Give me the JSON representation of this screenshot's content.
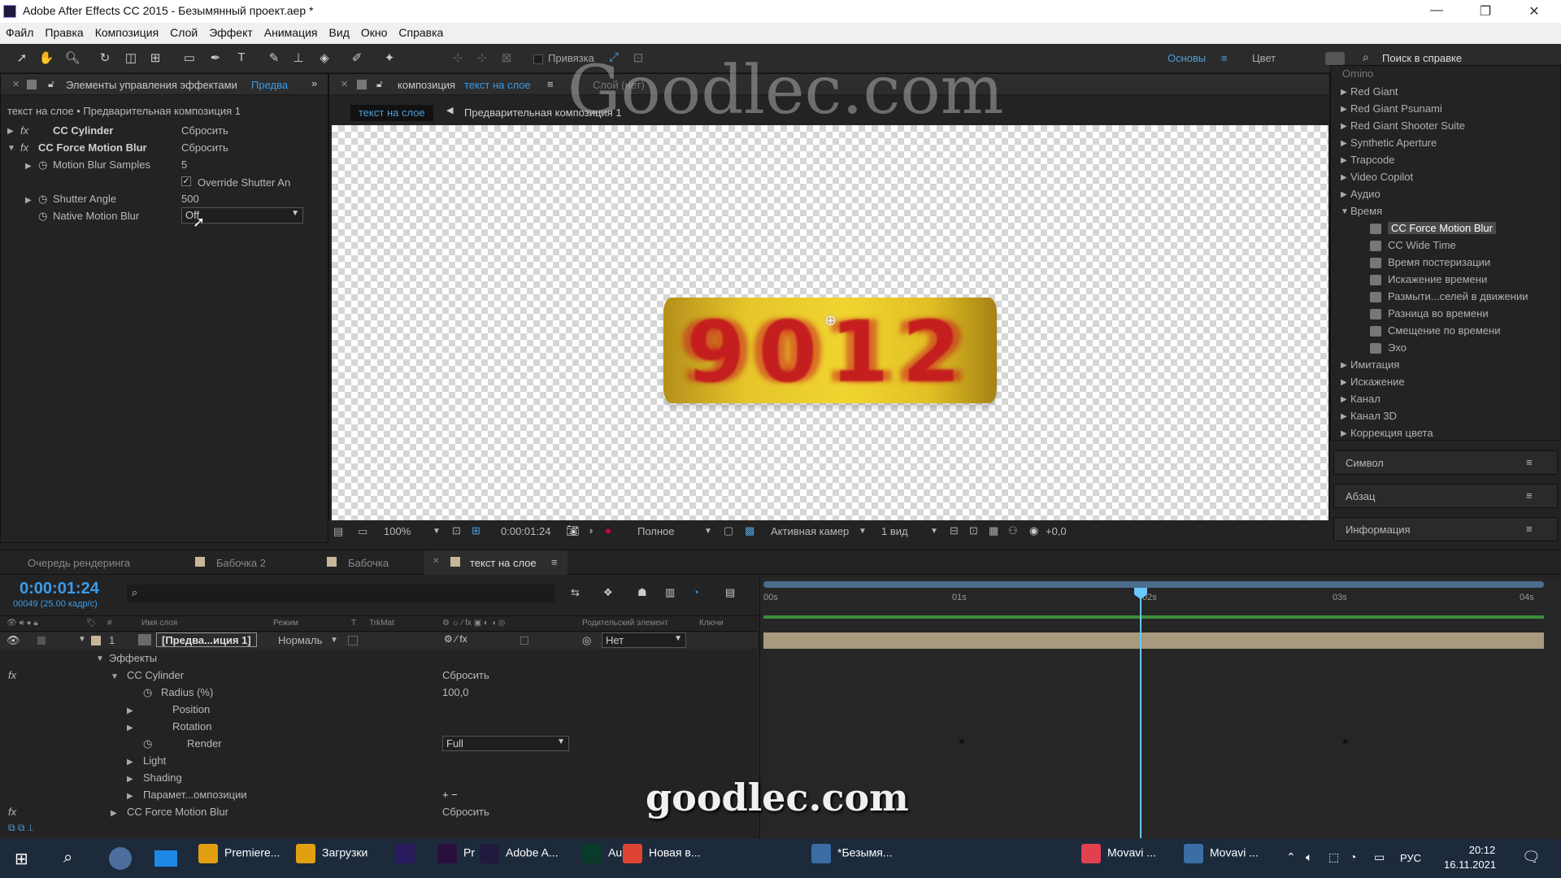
{
  "window": {
    "title": "Adobe After Effects CC 2015 - Безымянный проект.aep *"
  },
  "menu": [
    "Файл",
    "Правка",
    "Композиция",
    "Слой",
    "Эффект",
    "Анимация",
    "Вид",
    "Окно",
    "Справка"
  ],
  "toolbar": {
    "snap_label": "Привязка",
    "workspace_basics": "Основы",
    "workspace_color": "Цвет",
    "help_search_placeholder": "Поиск в справке"
  },
  "effects_panel": {
    "tab_label": "Элементы управления эффектами",
    "tab_suffix": "Предва",
    "breadcrumb": "текст на слое • Предварительная композиция 1",
    "effects": [
      {
        "name": "CC Cylinder",
        "reset": "Сбросить"
      },
      {
        "name": "CC Force Motion Blur",
        "reset": "Сбросить"
      }
    ],
    "motion_blur_samples": {
      "label": "Motion Blur Samples",
      "value": "5"
    },
    "override_shutter": {
      "label": "Override Shutter An",
      "checked": true
    },
    "shutter_angle": {
      "label": "Shutter Angle",
      "value": "500"
    },
    "native_motion_blur": {
      "label": "Native Motion Blur",
      "value": "Off"
    }
  },
  "composition_panel": {
    "tab_prefix": "композиция",
    "tab_name": "текст на слое",
    "layer_tab": "Слой (нет)",
    "crumbs": [
      "текст на слое",
      "Предварительная композиция 1"
    ],
    "cylinder_text": "9012",
    "footer": {
      "zoom": "100%",
      "timecode": "0:00:01:24",
      "resolution": "Полное",
      "camera": "Активная камер",
      "views": "1 вид",
      "exposure": "+0,0"
    }
  },
  "watermarks": {
    "top": "Goodlec.com",
    "bottom": "goodlec.com"
  },
  "effects_presets": {
    "partial_top": "Omino",
    "items": [
      "Red Giant",
      "Red Giant Psunami",
      "Red Giant Shooter Suite",
      "Synthetic Aperture",
      "Trapcode",
      "Video Copilot",
      "Аудио"
    ],
    "open_group": "Время",
    "time_effects": [
      "CC Force Motion Blur",
      "CC Wide Time",
      "Время постеризации",
      "Искажение времени",
      "Размыти...селей в движении",
      "Разница во времени",
      "Смещение по времени",
      "Эхо"
    ],
    "after_groups": [
      "Имитация",
      "Искажение",
      "Канал",
      "Канал 3D",
      "Коррекция цвета"
    ]
  },
  "side_panels": [
    "Символ",
    "Абзац",
    "Информация"
  ],
  "timeline": {
    "tabs": [
      "Очередь рендеринга",
      "Бабочка 2",
      "Бабочка",
      "текст на слое"
    ],
    "timecode": "0:00:01:24",
    "frame_info": "00049 (25.00 кадр/с)",
    "columns": {
      "name": "Имя слоя",
      "mode": "Режим",
      "t": "T",
      "trkmat": "TrkMat",
      "parent": "Родительский элемент",
      "keys": "Ключи"
    },
    "layer": {
      "num": "1",
      "name": "[Предва...иция 1]",
      "mode": "Нормаль",
      "parent": "Нет"
    },
    "effects_group": "Эффекты",
    "cc_cylinder": {
      "name": "CC Cylinder",
      "reset": "Сбросить"
    },
    "radius": {
      "label": "Radius (%)",
      "value": "100,0"
    },
    "props": [
      "Position",
      "Rotation"
    ],
    "render": {
      "label": "Render",
      "value": "Full"
    },
    "props2": [
      "Light",
      "Shading",
      "Парамет...омпозиции"
    ],
    "param_ops": "+ −",
    "cc_force": {
      "name": "CC Force Motion Blur",
      "reset": "Сбросить"
    },
    "ruler": [
      "00s",
      "01s",
      "02s",
      "03s",
      "04s"
    ]
  },
  "taskbar": {
    "apps": [
      "Premiere...",
      "Загрузки",
      "",
      "Pr",
      "Adobe A...",
      "Au",
      "Новая в...",
      "*Безымя...",
      "Movavi ...",
      "Movavi ..."
    ],
    "lang": "РУС",
    "time": "20:12",
    "date": "16.11.2021"
  },
  "colors": {
    "accent_blue": "#3b9be8",
    "playhead": "#6ac6ff",
    "layer_bar": "#a79a7f",
    "cylinder_yellow": "#e6c52a",
    "cylinder_text": "#c41e1e"
  }
}
